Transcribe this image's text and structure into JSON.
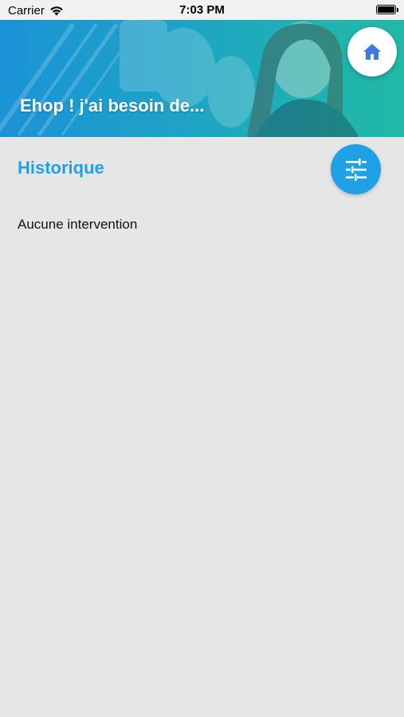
{
  "status_bar": {
    "carrier": "Carrier",
    "time": "7:03 PM"
  },
  "header": {
    "title": "Ehop ! j'ai besoin de...",
    "home_icon": "home-icon"
  },
  "history": {
    "title": "Historique",
    "filter_icon": "tune-sliders-icon",
    "empty_message": "Aucune intervention"
  },
  "colors": {
    "accent": "#1fa1e6",
    "home_icon": "#3f7ae0",
    "background": "#e6e6e6"
  }
}
